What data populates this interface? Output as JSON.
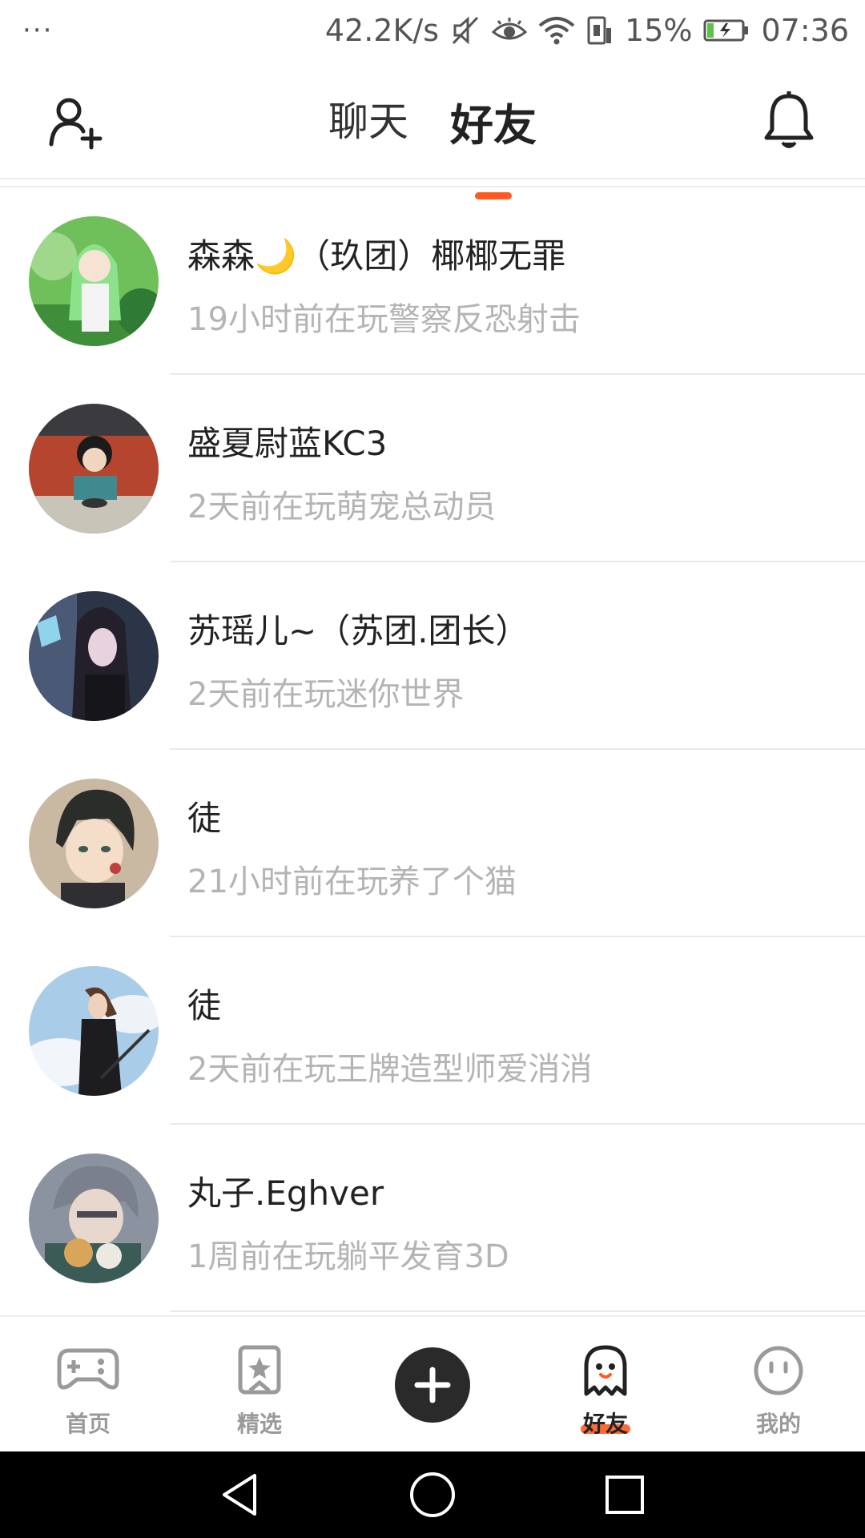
{
  "status_bar": {
    "dots": "···",
    "speed": "42.2K/s",
    "battery_percent": "15%",
    "time": "07:36"
  },
  "header": {
    "tabs": [
      {
        "label": "聊天",
        "active": false
      },
      {
        "label": "好友",
        "active": true
      }
    ],
    "accent_color": "#ff5a1f"
  },
  "friends": [
    {
      "name": "森森🌙（玖团）椰椰无罪",
      "status": "19小时前在玩警察反恐射击"
    },
    {
      "name": "盛夏尉蓝KC3",
      "status": "2天前在玩萌宠总动员"
    },
    {
      "name": "苏瑶儿~（苏团.团长）",
      "status": "2天前在玩迷你世界"
    },
    {
      "name": "徒",
      "status": "21小时前在玩养了个猫"
    },
    {
      "name": "徒",
      "status": "2天前在玩王牌造型师爱消消"
    },
    {
      "name": "丸子.Eghver",
      "status": "1周前在玩躺平发育3D"
    }
  ],
  "bottom_nav": {
    "home": "首页",
    "featured": "精选",
    "friends": "好友",
    "mine": "我的"
  }
}
